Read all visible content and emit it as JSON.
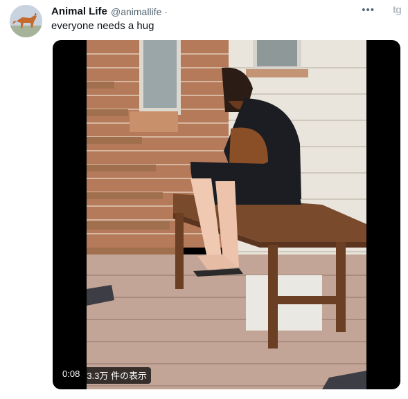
{
  "tweet": {
    "author_name": "Animal Life",
    "author_handle": "@animallife",
    "separator": "·",
    "text": "everyone needs a hug",
    "menu_icon": "more-horizontal-icon",
    "brand_icon": "tg"
  },
  "media": {
    "duration": "0:08",
    "views": "3.3万 件の表示"
  },
  "colors": {
    "text_primary": "#0f1419",
    "text_secondary": "#536471",
    "media_background": "#000000"
  }
}
